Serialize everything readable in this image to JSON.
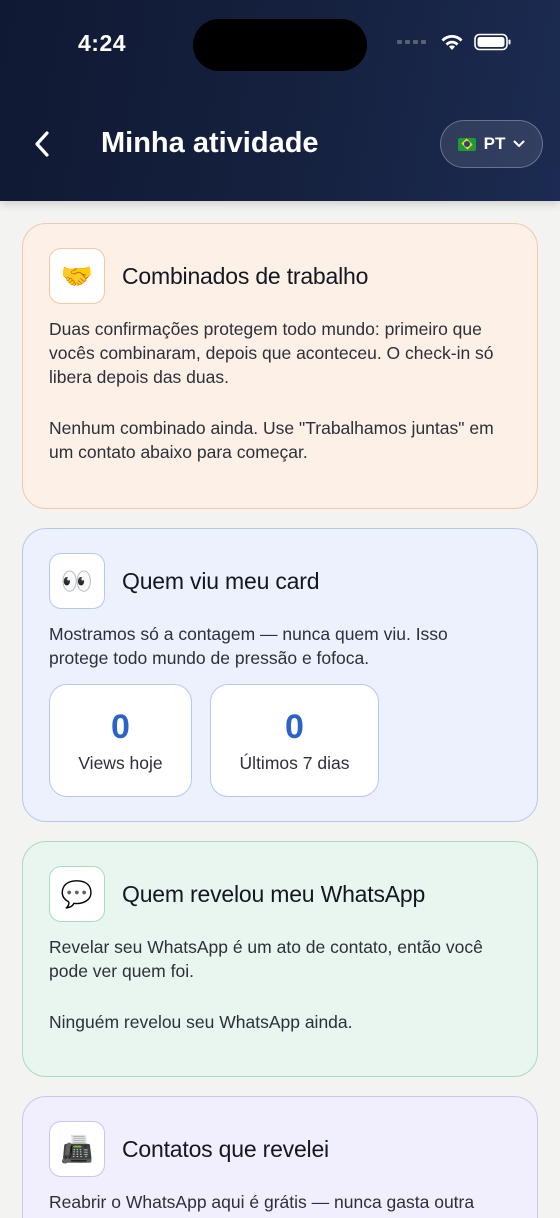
{
  "status_bar": {
    "time": "4:24"
  },
  "header": {
    "title": "Minha atividade",
    "language": "PT"
  },
  "cards": {
    "agreements": {
      "icon": "🤝",
      "title": "Combinados de trabalho",
      "text": "Duas confirmações protegem todo mundo: primeiro que vocês combinaram, depois que aconteceu. O check-in só libera depois das duas.",
      "empty": "Nenhum combinado ainda. Use \"Trabalhamos juntas\" em um contato abaixo para começar."
    },
    "views": {
      "icon": "👀",
      "title": "Quem viu meu card",
      "text": "Mostramos só a contagem — nunca quem viu. Isso protege todo mundo de pressão e fofoca.",
      "stats": [
        {
          "value": "0",
          "label": "Views hoje"
        },
        {
          "value": "0",
          "label": "Últimos 7 dias"
        }
      ]
    },
    "whatsapp": {
      "icon": "💬",
      "title": "Quem revelou meu WhatsApp",
      "text": "Revelar seu WhatsApp é um ato de contato, então você pode ver quem foi.",
      "empty": "Ninguém revelou seu WhatsApp ainda."
    },
    "revealed": {
      "icon": "📠",
      "title": "Contatos que revelei",
      "text": "Reabrir o WhatsApp aqui é grátis — nunca gasta outra"
    }
  }
}
